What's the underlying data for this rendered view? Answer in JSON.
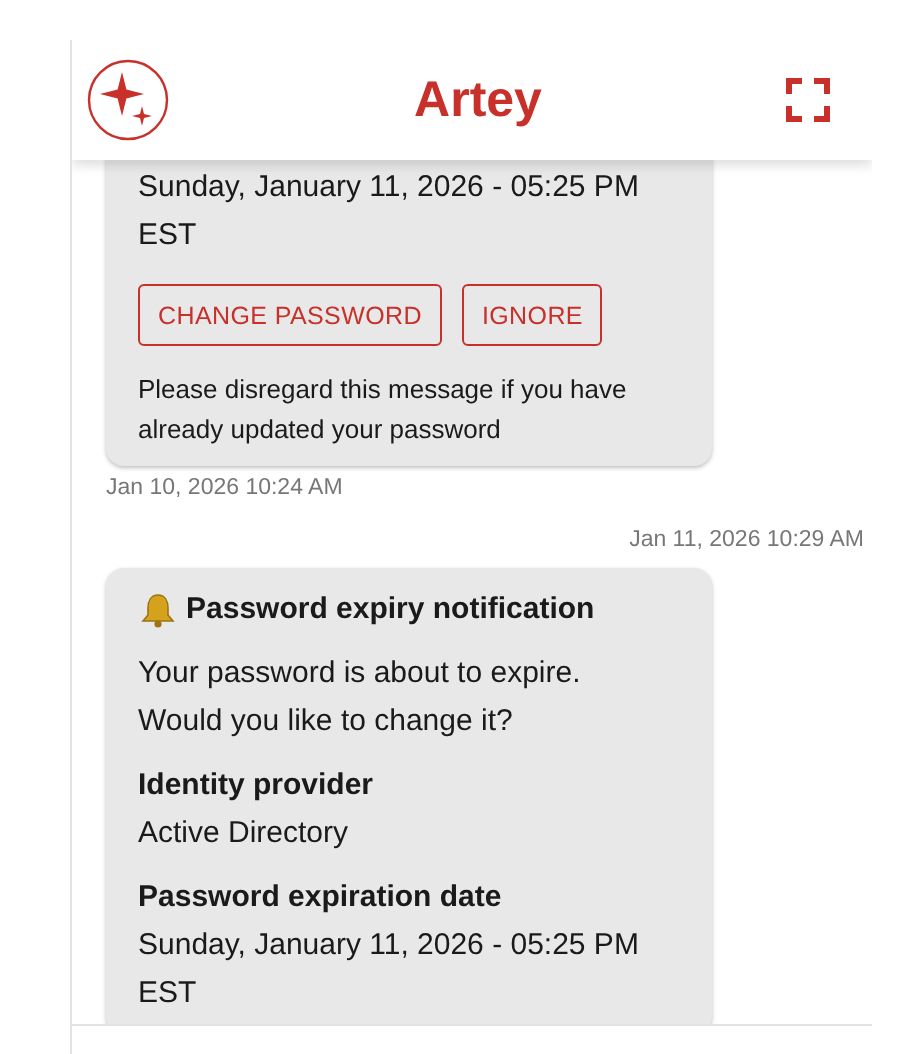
{
  "header": {
    "title": "Artey"
  },
  "feed": [
    {
      "kind": "card",
      "value": "Sunday, January 11, 2026 - 05:25 PM EST",
      "actions": [
        "CHANGE PASSWORD",
        "IGNORE"
      ],
      "note": "Please disregard this message if you have already updated your password",
      "timestamp": "Jan 10, 2026 10:24 AM"
    },
    {
      "kind": "date_header",
      "text": "Jan 11, 2026 10:29 AM"
    },
    {
      "kind": "notification",
      "title": "Password expiry notification",
      "message": "Your password is about to expire. Would you like to change it?",
      "fields": [
        {
          "label": "Identity provider",
          "value": "Active Directory"
        },
        {
          "label": "Password expiration date",
          "value": "Sunday, January 11, 2026 - 05:25 PM EST"
        }
      ]
    }
  ]
}
